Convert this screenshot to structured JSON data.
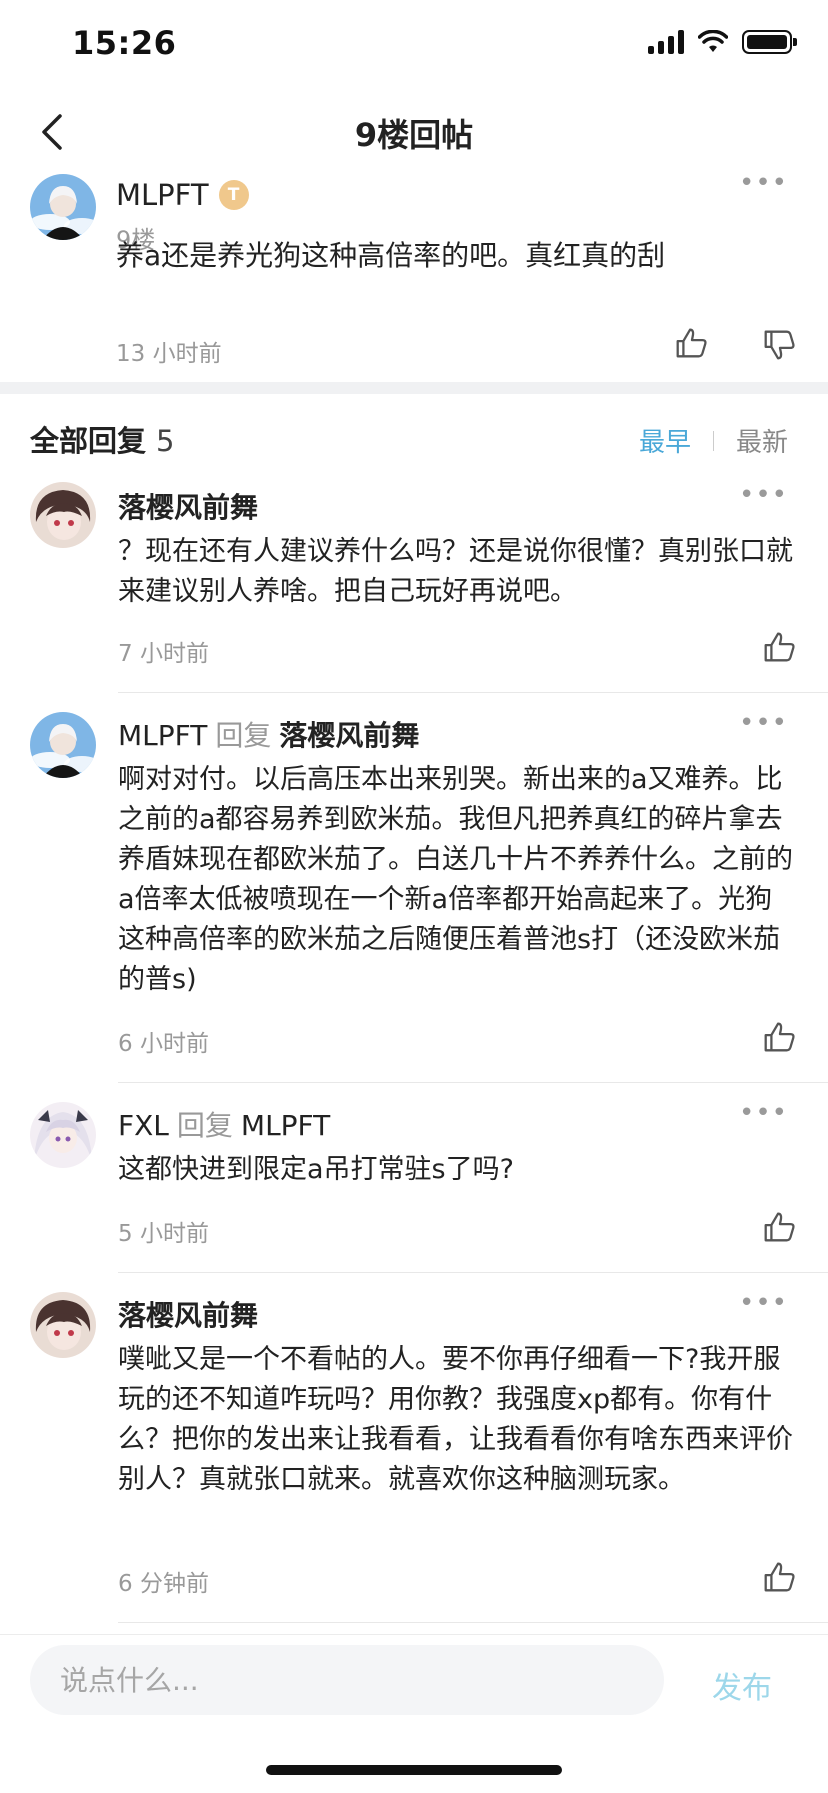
{
  "status_bar": {
    "time": "15:26"
  },
  "nav": {
    "title": "9楼回帖"
  },
  "main_post": {
    "username": "MLPFT",
    "badge": "T",
    "floor": "9楼",
    "content": "养a还是养光狗这种高倍率的吧。真红真的刮",
    "time": "13 小时前"
  },
  "replies_header": {
    "title": "全部回复",
    "count": "5",
    "sort_earliest": "最早",
    "sort_latest": "最新"
  },
  "colors": {
    "accent": "#4aa8d8",
    "publish": "#9dd7ea"
  },
  "replies": [
    {
      "author": "落樱风前舞",
      "reply_label": "",
      "reply_to": "",
      "content": "？现在还有人建议养什么吗？还是说你很懂？真别张口就来建议别人养啥。把自己玩好再说吧。",
      "time": "7 小时前"
    },
    {
      "author": "MLPFT",
      "reply_label": "回复",
      "reply_to": "落樱风前舞",
      "content": "啊对对付。以后高压本出来别哭。新出来的a又难养。比之前的a都容易养到欧米茄。我但凡把养真红的碎片拿去养盾妹现在都欧米茄了。白送几十片不养养什么。之前的a倍率太低被喷现在一个新a倍率都开始高起来了。光狗这种高倍率的欧米茄之后随便压着普池s打（还没欧米茄的普s)",
      "time": "6 小时前"
    },
    {
      "author": "FXL",
      "reply_label": "回复",
      "reply_to": "MLPFT",
      "content": "这都快进到限定a吊打常驻s了吗?",
      "time": "5 小时前"
    },
    {
      "author": "落樱风前舞",
      "reply_label": "",
      "reply_to": "",
      "content": "噗呲又是一个不看帖的人。要不你再仔细看一下?我开服玩的还不知道咋玩吗？用你教？我强度xp都有。你有什么？把你的发出来让我看看，让我看看你有啥东西来评价别人？真就张口就来。就喜欢你这种脑测玩家。",
      "time": "6 分钟前"
    }
  ],
  "comment_box": {
    "placeholder": "说点什么...",
    "publish": "发布"
  }
}
